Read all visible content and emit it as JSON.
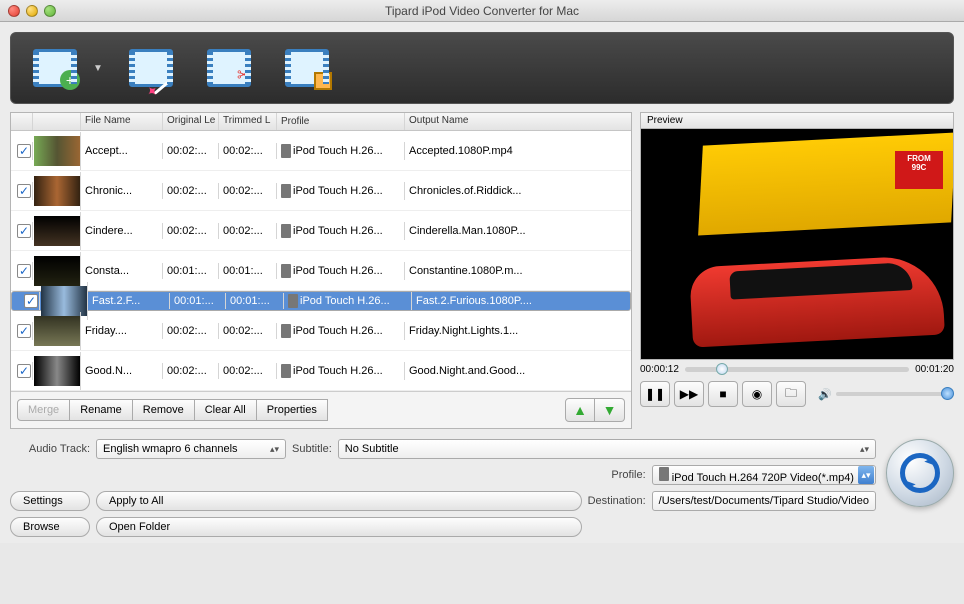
{
  "title": "Tipard iPod Video Converter for Mac",
  "columns": {
    "filename": "File Name",
    "original": "Original Le",
    "trimmed": "Trimmed L",
    "profile": "Profile",
    "output": "Output Name"
  },
  "rows": [
    {
      "name": "Accept...",
      "orig": "00:02:...",
      "trim": "00:02:...",
      "prof": "iPod Touch H.26...",
      "out": "Accepted.1080P.mp4",
      "selected": false
    },
    {
      "name": "Chronic...",
      "orig": "00:02:...",
      "trim": "00:02:...",
      "prof": "iPod Touch H.26...",
      "out": "Chronicles.of.Riddick...",
      "selected": false
    },
    {
      "name": "Cindere...",
      "orig": "00:02:...",
      "trim": "00:02:...",
      "prof": "iPod Touch H.26...",
      "out": "Cinderella.Man.1080P...",
      "selected": false
    },
    {
      "name": "Consta...",
      "orig": "00:01:...",
      "trim": "00:01:...",
      "prof": "iPod Touch H.26...",
      "out": "Constantine.1080P.m...",
      "selected": false
    },
    {
      "name": "Fast.2.F...",
      "orig": "00:01:...",
      "trim": "00:01:...",
      "prof": "iPod Touch H.26...",
      "out": "Fast.2.Furious.1080P....",
      "selected": true
    },
    {
      "name": "Friday....",
      "orig": "00:02:...",
      "trim": "00:02:...",
      "prof": "iPod Touch H.26...",
      "out": "Friday.Night.Lights.1...",
      "selected": false
    },
    {
      "name": "Good.N...",
      "orig": "00:02:...",
      "trim": "00:02:...",
      "prof": "iPod Touch H.26...",
      "out": "Good.Night.and.Good...",
      "selected": false
    }
  ],
  "actions": {
    "merge": "Merge",
    "rename": "Rename",
    "remove": "Remove",
    "clearall": "Clear All",
    "properties": "Properties"
  },
  "preview": {
    "label": "Preview",
    "time_current": "00:00:12",
    "time_total": "00:01:20",
    "bussign1": "FROM",
    "bussign2": "99C"
  },
  "form": {
    "audiotrack_label": "Audio Track:",
    "audiotrack_value": "English wmapro 6 channels",
    "subtitle_label": "Subtitle:",
    "subtitle_value": "No Subtitle",
    "profile_label": "Profile:",
    "profile_value": "iPod Touch H.264 720P Video(*.mp4)",
    "destination_label": "Destination:",
    "destination_value": "/Users/test/Documents/Tipard Studio/Video",
    "settings": "Settings",
    "applyall": "Apply to All",
    "browse": "Browse",
    "openfolder": "Open Folder"
  }
}
